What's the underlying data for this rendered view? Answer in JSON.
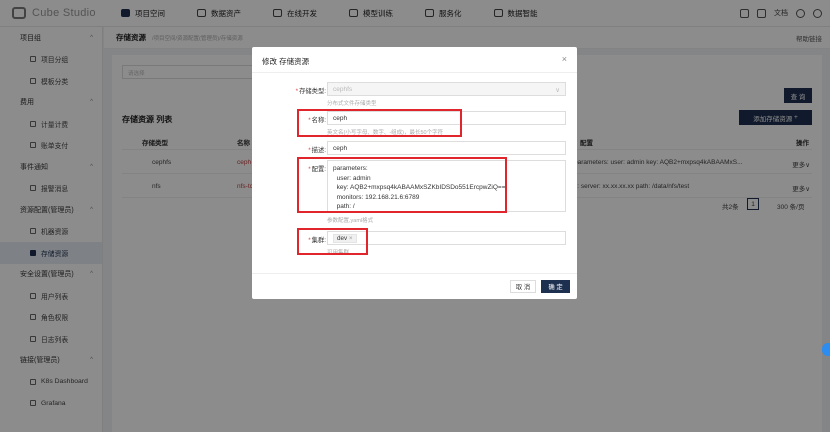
{
  "topbar": {
    "logo": "Cube Studio",
    "nav": [
      {
        "label": "项目空间",
        "active": true
      },
      {
        "label": "数据资产",
        "active": false
      },
      {
        "label": "在线开发",
        "active": false
      },
      {
        "label": "模型训练",
        "active": false
      },
      {
        "label": "服务化",
        "active": false
      },
      {
        "label": "数据智能",
        "active": false
      }
    ],
    "doc": "文档"
  },
  "sidebar": {
    "groups": [
      {
        "label": "项目组",
        "items": [
          "项目分组",
          "模板分类"
        ]
      },
      {
        "label": "费用",
        "items": [
          "计量计费",
          "账单支付"
        ]
      },
      {
        "label": "事件通知",
        "items": [
          "报警消息"
        ]
      },
      {
        "label": "资源配置(管理员)",
        "items": [
          "机器资源",
          "存储资源"
        ]
      },
      {
        "label": "安全设置(管理员)",
        "items": [
          "用户列表",
          "角色权限",
          "日志列表"
        ]
      },
      {
        "label": "链接(管理员)",
        "items": [
          "K8s Dashboard",
          "Grafana"
        ]
      }
    ],
    "active_item": "存储资源"
  },
  "page": {
    "title": "存储资源",
    "breadcrumb": "/项目空间/资源配置(管理员)/存储资源",
    "help": "帮助链接",
    "filter_placeholder": "请选择",
    "search_btn": "查 询",
    "list_title": "存储资源 列表",
    "add_btn": "添加存储资源",
    "columns": [
      "存储类型",
      "名称",
      "配置",
      "操作"
    ],
    "rows": [
      {
        "type": "cephfs",
        "name": "ceph",
        "config": "parameters: user: admin key: AQB2+mxpsq4kABAAMxS...",
        "action": "更多"
      },
      {
        "type": "nfs",
        "name": "nfs-tc",
        "config": "s: server: xx.xx.xx.xx path: /data/nfs/test",
        "action": "更多"
      }
    ],
    "total": "共2条",
    "page_num": "1",
    "page_size": "300 条/页"
  },
  "modal": {
    "title": "修改 存储资源",
    "fields": {
      "type": {
        "label": "存储类型:",
        "value": "cephfs",
        "hint": "分布式文件存储类型"
      },
      "name": {
        "label": "名称:",
        "value": "ceph",
        "hint": "英文名(小写字母、数字、-组成)，最长50个字符"
      },
      "desc": {
        "label": "描述:",
        "value": "ceph"
      },
      "config": {
        "label": "配置:",
        "lines": [
          "parameters:",
          "  user: admin",
          "  key: AQB2+mxpsq4kABAAMxSZKbIDSDo551ErcpwZiQ==",
          "  monitors: 192.168.21.6:6789",
          "  path: /"
        ],
        "hint": "参数配置,yaml格式"
      },
      "cluster": {
        "label": "集群:",
        "tag": "dev",
        "hint": "可用集群"
      }
    },
    "cancel": "取 消",
    "ok": "确 定"
  },
  "colors": {
    "primary": "#1e3050",
    "highlight": "#e0262c",
    "required": "#e04040"
  }
}
